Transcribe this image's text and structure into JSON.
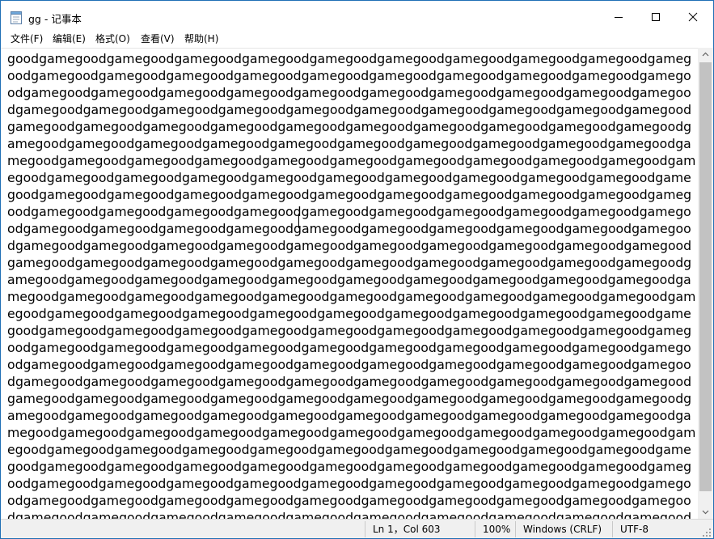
{
  "window": {
    "title": "gg - 记事本",
    "icons": {
      "app": "notepad-icon",
      "minimize": "minimize-icon",
      "maximize": "maximize-icon",
      "close": "close-icon"
    }
  },
  "menu": {
    "file": "文件(F)",
    "edit": "编辑(E)",
    "format": "格式(O)",
    "view": "查看(V)",
    "help": "帮助(H)"
  },
  "editor": {
    "lines": [
      "goodgamegoodgamegoodgamegoodgamegoodgamegoodgamegoodgamegoodgamegoodgamegoodgameg",
      "oodgamegoodgamegoodgamegoodgamegoodgamegoodgamegoodgamegoodgamegoodgamegoodgamego",
      "odgamegoodgamegoodgamegoodgamegoodgamegoodgamegoodgamegoodgamegoodgamegoodgamegoo",
      "dgamegoodgamegoodgamegoodgamegoodgamegoodgamegoodgamegoodgamegoodgamegoodgamegood",
      "gamegoodgamegoodgamegoodgamegoodgamegoodgamegoodgamegoodgamegoodgamegoodgamegoodg",
      "amegoodgamegoodgamegoodgamegoodgamegoodgamegoodgamegoodgamegoodgamegoodgamegoodga",
      "megoodgamegoodgamegoodgamegoodgamegoodgamegoodgamegoodgamegoodgamegoodgamegoodgam",
      "egoodgamegoodgamegoodgamegoodgamegoodgamegoodgamegoodgamegoodgamegoodgamegoodgame",
      "goodgamegoodgamegoodgamegoodgamegoodgamegoodgamegoodgamegoodgamegoodgamegoodgameg",
      "oodgamegoodgamegoodgamegoodgamegoodgamegoodgamegoodgamegoodgamegoodgamegoodgamego",
      "odgamegoodgamegoodgamegoodgamegoodgamegoodgamegoodgamegoodgamegoodgamegoodgamegoo",
      "dgamegoodgamegoodgamegoodgamegoodgamegoodgamegoodgamegoodgamegoodgamegoodgamegood",
      "gamegoodgamegoodgamegoodgamegoodgamegoodgamegoodgamegoodgamegoodgamegoodgamegoodg",
      "amegoodgamegoodgamegoodgamegoodgamegoodgamegoodgamegoodgamegoodgamegoodgamegoodga",
      "megoodgamegoodgamegoodgamegoodgamegoodgamegoodgamegoodgamegoodgamegoodgamegoodgam",
      "egoodgamegoodgamegoodgamegoodgamegoodgamegoodgamegoodgamegoodgamegoodgamegoodgame",
      "goodgamegoodgamegoodgamegoodgamegoodgamegoodgamegoodgamegoodgamegoodgamegoodgameg",
      "oodgamegoodgamegoodgamegoodgamegoodgamegoodgamegoodgamegoodgamegoodgamegoodgamego",
      "odgamegoodgamegoodgamegoodgamegoodgamegoodgamegoodgamegoodgamegoodgamegoodgamegoo",
      "dgamegoodgamegoodgamegoodgamegoodgamegoodgamegoodgamegoodgamegoodgamegoodgamegood",
      "gamegoodgamegoodgamegoodgamegoodgamegoodgamegoodgamegoodgamegoodgamegoodgamegoodg",
      "amegoodgamegoodgamegoodgamegoodgamegoodgamegoodgamegoodgamegoodgamegoodgamegoodga",
      "megoodgamegoodgamegoodgamegoodgamegoodgamegoodgamegoodgamegoodgamegoodgamegoodgam",
      "egoodgamegoodgamegoodgamegoodgamegoodgamegoodgamegoodgamegoodgamegoodgamegoodgame",
      "goodgamegoodgamegoodgamegoodgamegoodgamegoodgamegoodgamegoodgamegoodgamegoodgameg",
      "oodgamegoodgamegoodgamegoodgamegoodgamegoodgamegoodgamegoodgamegoodgamegoodgamego",
      "odgamegoodgamegoodgamegoodgamegoodgamegoodgamegoodgamegoodgamegoodgamegoodgamegoo",
      "dgamegoodgamegoodgamegoodgamegoodgamegoodgamegoodgamegoodgamegoodgamegoodgamegood"
    ]
  },
  "status": {
    "position": "Ln 1，Col 603",
    "zoom": "100%",
    "line_ending": "Windows (CRLF)",
    "encoding": "UTF-8"
  },
  "colors": {
    "border": "#1f6fb5",
    "statusbar": "#f0f0f0",
    "scroll_thumb": "#c2c2c2"
  }
}
